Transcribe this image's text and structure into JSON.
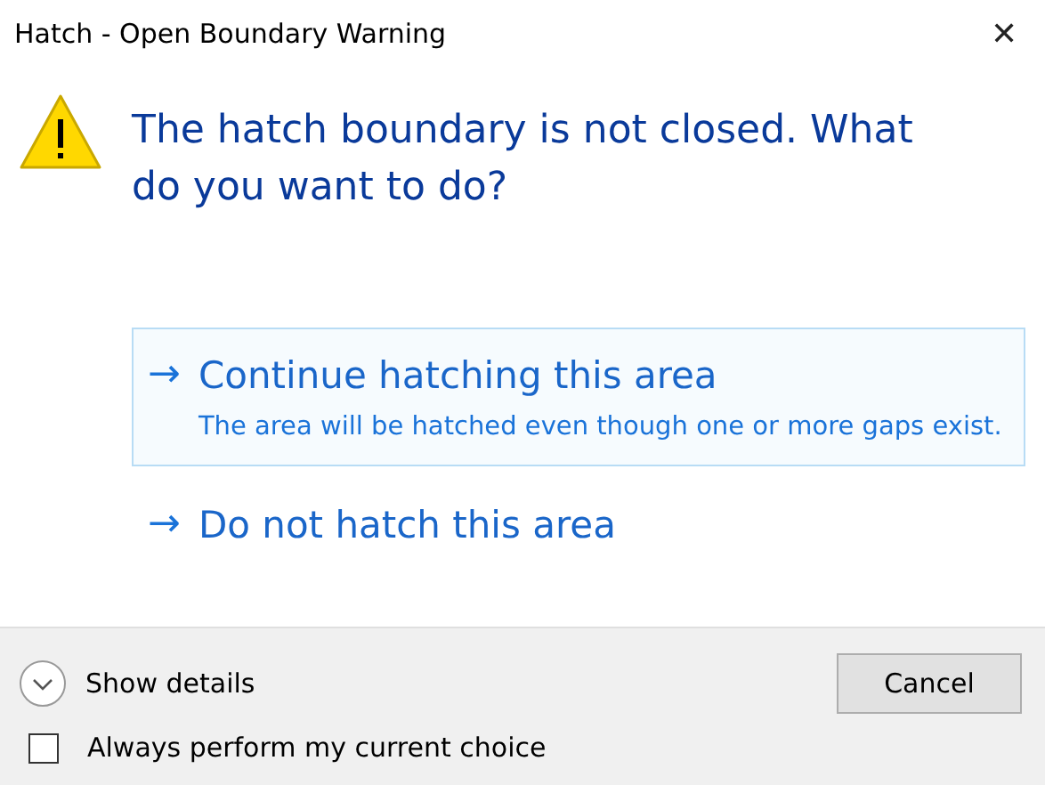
{
  "window": {
    "title": "Hatch - Open Boundary Warning",
    "close": "✕"
  },
  "instruction": "The hatch boundary is not closed. What do you want to do?",
  "options": [
    {
      "arrow": "→",
      "label": "Continue hatching this area",
      "description": "The area will be hatched even though one or more gaps exist.",
      "selected": true
    },
    {
      "arrow": "→",
      "label": "Do not hatch this area",
      "selected": false
    }
  ],
  "footer": {
    "details": {
      "label": "Show details",
      "expanded": false
    },
    "cancel": "Cancel",
    "always": {
      "label": "Always perform my current choice",
      "checked": false
    }
  }
}
